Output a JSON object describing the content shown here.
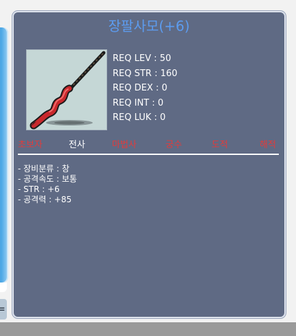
{
  "tooltip": {
    "title": "장팔사모(+6)",
    "title_color": "#5c9cf0",
    "background_color": "#5f6a84",
    "image_icon": "spear-icon",
    "requirements": [
      "REQ LEV : 50",
      "REQ STR : 160",
      "REQ DEX : 0",
      "REQ INT : 0",
      "REQ LUK : 0"
    ],
    "jobs": [
      {
        "label": "초보자",
        "active": false
      },
      {
        "label": "전사",
        "active": true
      },
      {
        "label": "마법사",
        "active": false
      },
      {
        "label": "궁수",
        "active": false
      },
      {
        "label": "도적",
        "active": false
      },
      {
        "label": "해적",
        "active": false
      }
    ],
    "job_active_color": "#ffffff",
    "job_inactive_color": "#e03c3c",
    "stats": [
      "- 장비분류 : 창",
      "- 공격속도 : 보통",
      "- STR : +6",
      "- 공격력 : +85"
    ]
  },
  "background": {
    "tab_label": "="
  }
}
